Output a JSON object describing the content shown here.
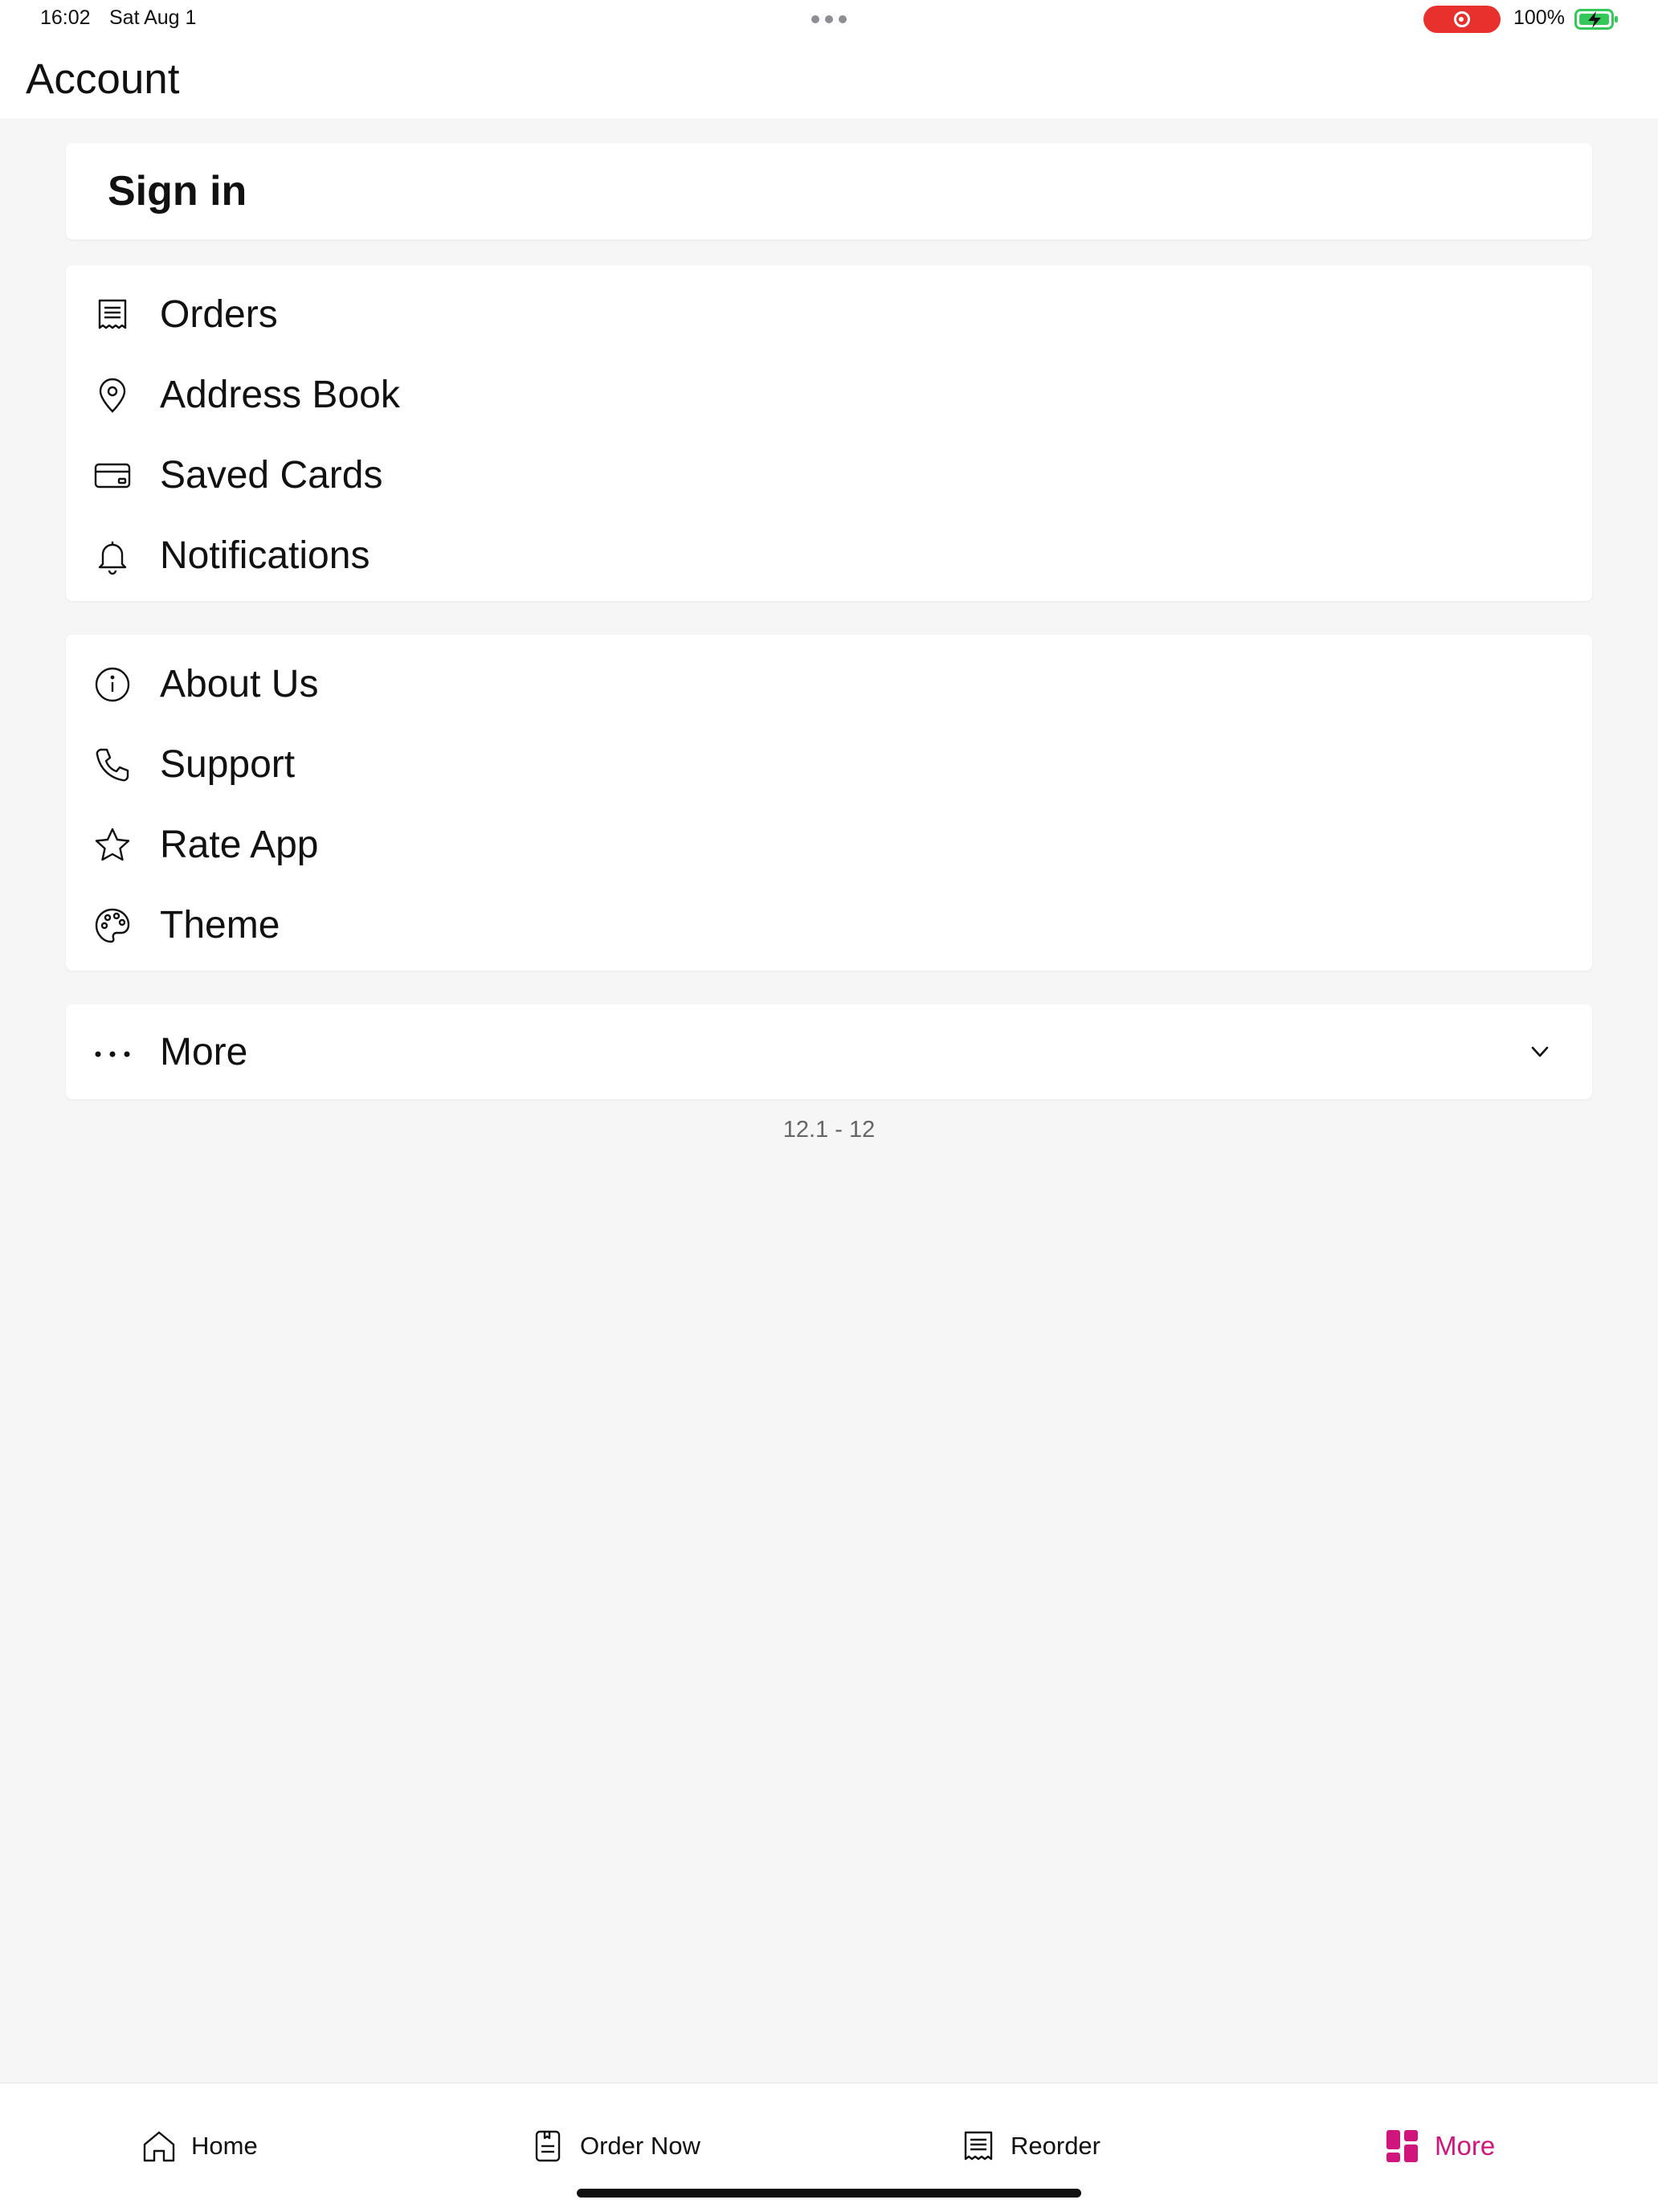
{
  "status_bar": {
    "time": "16:02",
    "date": "Sat Aug 1",
    "battery": "100%",
    "record_color": "#e8312c",
    "battery_color": "#34c759"
  },
  "header": {
    "title": "Account"
  },
  "sign_in": {
    "label": "Sign in"
  },
  "account_items": [
    {
      "label": "Orders",
      "icon": "receipt-icon"
    },
    {
      "label": "Address Book",
      "icon": "location-pin-icon"
    },
    {
      "label": "Saved Cards",
      "icon": "credit-card-icon"
    },
    {
      "label": "Notifications",
      "icon": "bell-icon"
    }
  ],
  "info_items": [
    {
      "label": "About Us",
      "icon": "info-icon"
    },
    {
      "label": "Support",
      "icon": "phone-icon"
    },
    {
      "label": "Rate App",
      "icon": "star-icon"
    },
    {
      "label": "Theme",
      "icon": "palette-icon"
    }
  ],
  "more_section": {
    "label": "More",
    "icon": "ellipsis-icon",
    "chevron": "chevron-down-icon"
  },
  "version": "12.1 - 12",
  "tab_bar": {
    "accent_color": "#d0157c",
    "tabs": [
      {
        "label": "Home",
        "icon": "home-icon"
      },
      {
        "label": "Order Now",
        "icon": "order-icon"
      },
      {
        "label": "Reorder",
        "icon": "receipt-icon"
      },
      {
        "label": "More",
        "icon": "grid-icon",
        "active": true
      }
    ]
  }
}
